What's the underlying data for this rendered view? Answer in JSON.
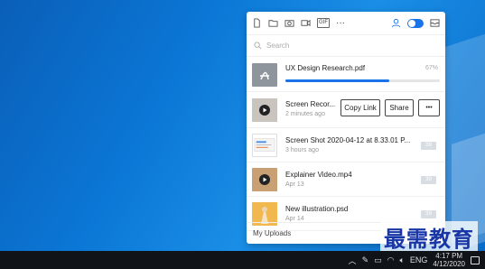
{
  "toolbar": {
    "icons": [
      "file-icon",
      "folder-icon",
      "camera-icon",
      "video-icon",
      "gif-icon",
      "more-icon",
      "user-icon",
      "toggle",
      "inbox-icon"
    ],
    "gif_label": "GIF",
    "more_label": "···"
  },
  "search": {
    "placeholder": "Search"
  },
  "items": [
    {
      "title": "UX Design Research.pdf",
      "progress": 0.67,
      "progress_label": "67%"
    },
    {
      "title": "Screen Recor...",
      "subtitle": "2 minutes ago",
      "copy_link": "Copy Link",
      "share": "Share",
      "more": "•••"
    },
    {
      "title": "Screen Shot 2020-04-12 at 8.33.01 P...",
      "subtitle": "3 hours ago",
      "badge": "39"
    },
    {
      "title": "Explainer Video.mp4",
      "subtitle": "Apr 13",
      "badge": "39"
    },
    {
      "title": "New illustration.psd",
      "subtitle": "Apr 14",
      "badge": "39"
    }
  ],
  "footer": {
    "label": "My Uploads"
  },
  "taskbar": {
    "lang": "ENG",
    "time": "4:17 PM",
    "date": "4/12/2020"
  },
  "watermark": "最需教育",
  "colors": {
    "accent": "#1a73e8",
    "desktop": "#0b77d6",
    "taskbar": "#101418"
  }
}
